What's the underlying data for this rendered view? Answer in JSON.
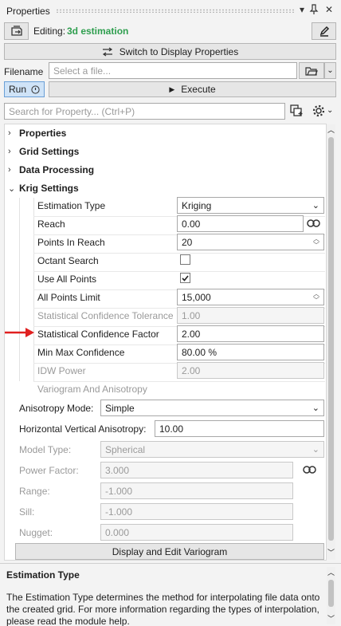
{
  "window": {
    "title": "Properties"
  },
  "editing": {
    "label": "Editing:",
    "name": "3d estimation",
    "name_color": "#2e9e4e"
  },
  "toolbar": {
    "switch_label": "Switch to Display Properties"
  },
  "filename": {
    "label": "Filename",
    "placeholder": "Select a file..."
  },
  "run": {
    "label": "Run",
    "execute_label": "Execute"
  },
  "search": {
    "placeholder": "Search for Property... (Ctrl+P)"
  },
  "sections": [
    {
      "label": "Properties",
      "expanded": false
    },
    {
      "label": "Grid Settings",
      "expanded": false
    },
    {
      "label": "Data Processing",
      "expanded": false
    },
    {
      "label": "Krig Settings",
      "expanded": true
    }
  ],
  "krig": {
    "estimation_type": {
      "label": "Estimation Type",
      "value": "Kriging"
    },
    "reach": {
      "label": "Reach",
      "value": "0.00"
    },
    "points_in_reach": {
      "label": "Points In Reach",
      "value": "20"
    },
    "octant_search": {
      "label": "Octant Search",
      "checked": false
    },
    "use_all_points": {
      "label": "Use All Points",
      "checked": true
    },
    "all_points_limit": {
      "label": "All Points Limit",
      "value": "15,000"
    },
    "stat_conf_tolerance": {
      "label": "Statistical Confidence Tolerance",
      "value": "1.00"
    },
    "stat_conf_factor": {
      "label": "Statistical Confidence Factor",
      "value": "2.00"
    },
    "min_max_confidence": {
      "label": "Min Max Confidence",
      "value": "80.00 %"
    },
    "idw_power": {
      "label": "IDW Power",
      "value": "2.00"
    }
  },
  "variogram": {
    "heading": "Variogram And Anisotropy",
    "anisotropy_mode": {
      "label": "Anisotropy Mode:",
      "value": "Simple"
    },
    "hv_anisotropy": {
      "label": "Horizontal Vertical Anisotropy:",
      "value": "10.00"
    },
    "model_type": {
      "label": "Model Type:",
      "value": "Spherical"
    },
    "power_factor": {
      "label": "Power Factor:",
      "value": "3.000"
    },
    "range": {
      "label": "Range:",
      "value": "-1.000"
    },
    "sill": {
      "label": "Sill:",
      "value": "-1.000"
    },
    "nugget": {
      "label": "Nugget:",
      "value": "0.000"
    },
    "display_button": "Display and Edit Variogram"
  },
  "description": {
    "title": "Estimation Type",
    "text": "The Estimation Type determines the method for interpolating file data onto the created grid. For more information regarding the types of interpolation, please read the module help."
  },
  "colors": {
    "arrow": "#e02020",
    "accent_green": "#2e9e4e"
  },
  "icons": [
    "pin-icon",
    "close-icon",
    "dropdown-icon",
    "edit-icon",
    "switch-icon",
    "folder-icon",
    "info-icon",
    "play-icon",
    "copy-properties-icon",
    "gear-icon",
    "link-icon",
    "chevron-right-icon",
    "chevron-down-icon",
    "check-icon",
    "red-arrow-icon"
  ]
}
